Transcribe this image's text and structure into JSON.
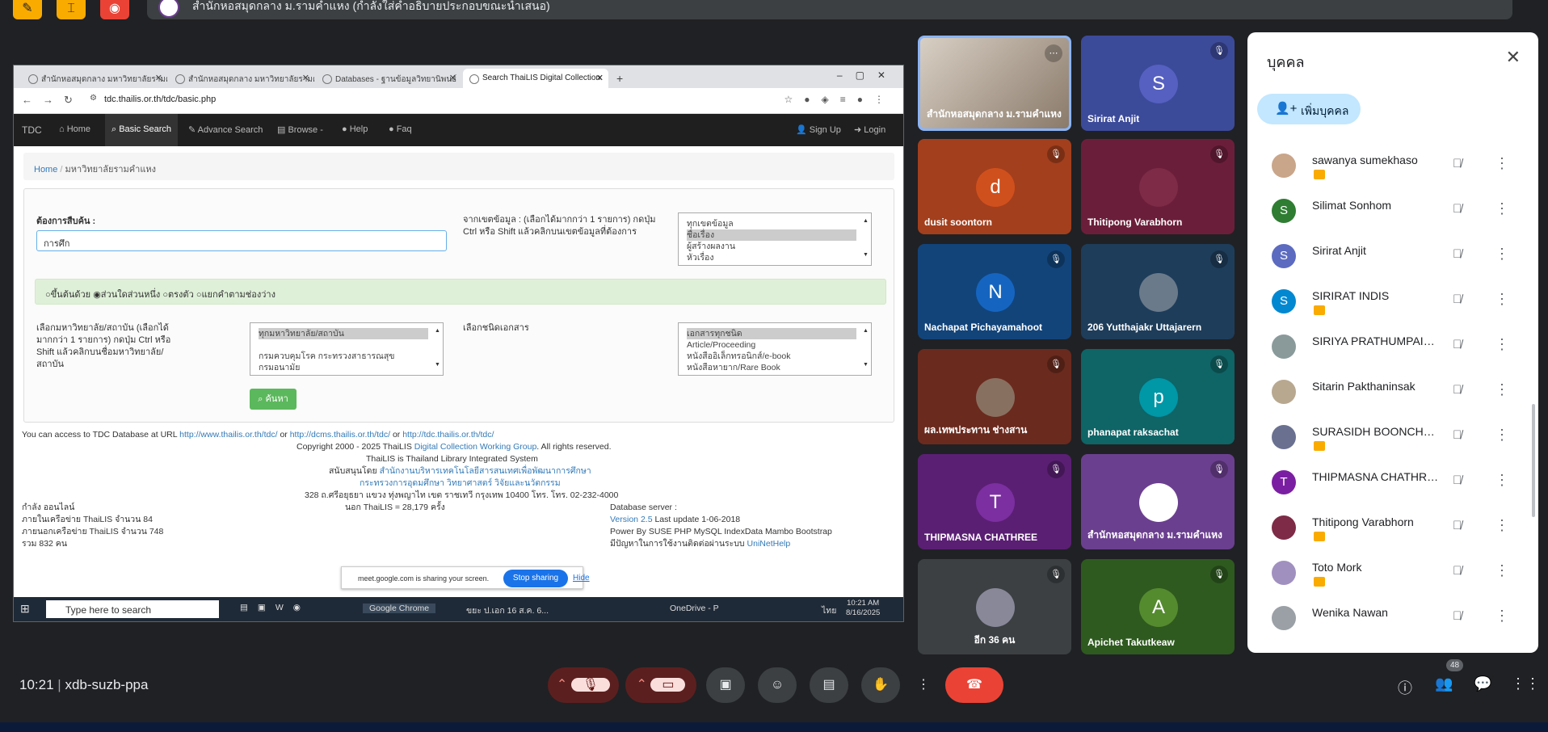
{
  "presentation": {
    "title": "สำนักหอสมุดกลาง ม.รามคำแหง (กำลังใส่คำอธิบายประกอบขณะนำเสนอ)"
  },
  "browser": {
    "tabs": [
      {
        "label": "สำนักหอสมุดกลาง มหาวิทยาลัยรามคำ"
      },
      {
        "label": "สำนักหอสมุดกลาง มหาวิทยาลัยรามคำ"
      },
      {
        "label": "Databases - ฐานข้อมูลวิทยานิพนธ์"
      },
      {
        "label": "Search ThaiLIS Digital Collection"
      }
    ],
    "url": "tdc.thailis.or.th/tdc/basic.php"
  },
  "site": {
    "brand": "TDC",
    "nav": [
      "Home",
      "Basic Search",
      "Advance Search",
      "Browse -",
      "Help",
      "Faq"
    ],
    "signup": "Sign Up",
    "login": "Login",
    "breadcrumb_home": "Home",
    "breadcrumb_current": "มหาวิทยาลัยรามคำแหง",
    "search_label": "ต้องการสืบค้น :",
    "search_value": "การศึก",
    "field_help": "จากเขตข้อมูล : (เลือกได้มากกว่า 1 รายการ) กดปุ่ม Ctrl หรือ Shift แล้วคลิกบนเขตข้อมูลที่ต้องการ",
    "fields": [
      "ทุกเขตข้อมูล",
      "ชื่อเรื่อง",
      "ผู้สร้างผลงาน",
      "หัวเรื่อง"
    ],
    "radios": [
      "ขึ้นต้นด้วย",
      "ส่วนใดส่วนหนึ่ง",
      "ตรงตัว",
      "แยกคำตามช่องว่าง"
    ],
    "inst_help": "เลือกมหาวิทยาลัย/สถาบัน (เลือกได้มากกว่า 1 รายการ) กดปุ่ม Ctrl หรือ Shift แล้วคลิกบนชื่อมหาวิทยาลัย/สถาบัน",
    "institutions": [
      "ทุกมหาวิทยาลัย/สถาบัน",
      "",
      "กรมควบคุมโรค กระทรวงสาธารณสุข",
      "กรมอนามัย"
    ],
    "doc_help": "เลือกชนิดเอกสาร",
    "doc_types": [
      "เอกสารทุกชนิด",
      "Article/Proceeding",
      "หนังสืออิเล็กทรอนิกส์/e-book",
      "หนังสือหายาก/Rare Book"
    ],
    "search_button": "ค้นหา",
    "footer_access": "You can access to TDC Database at URL",
    "footer_url1": "http://www.thailis.or.th/tdc/",
    "footer_or1": "or",
    "footer_url2": "http://dcms.thailis.or.th/tdc/",
    "footer_or2": "or",
    "footer_url3": "http://tdc.thailis.or.th/tdc/",
    "copyright": "Copyright 2000 - 2025 ThaiLIS",
    "copyright_link": "Digital Collection Working Group",
    "copyright_tail": ". All rights reserved.",
    "thailis_line": "ThaiLIS is Thailand Library Integrated System",
    "support_label": "สนับสนุนโดย",
    "support_org": "สำนักงานบริหารเทคโนโลยีสารสนเทศเพื่อพัฒนาการศึกษา",
    "ministry": "กระทรวงการอุดมศึกษา วิทยาศาสตร์ วิจัยและนวัตกรรม",
    "address": "328 ถ.ศรีอยุธยา แขวง ทุ่งพญาไท เขต ราชเทวี กรุงเทพ 10400 โทร. โทร. 02-232-4000",
    "online": "กำลัง ออนไลน์",
    "online_in": "ภายในเครือข่าย ThaiLIS จำนวน 84",
    "online_out": "ภายนอกเครือข่าย ThaiLIS จำนวน 748",
    "online_total": "รวม 832 คน",
    "outside": "นอก ThaiLIS = 28,179 ครั้ง",
    "db_server": "Database server :",
    "version": "Version 2.5",
    "last_update": "Last update 1-06-2018",
    "powered": "Power By SUSE PHP MySQL IndexData Mambo Bootstrap",
    "problem": "มีปัญหาในการใช้งานติดต่อผ่านระบบ",
    "help_link": "UniNetHelp"
  },
  "share_bar": {
    "text": "meet.google.com is sharing your screen.",
    "stop": "Stop sharing",
    "hide": "Hide"
  },
  "taskbar": {
    "search": "Type here to search",
    "chrome": "Google Chrome",
    "doc": "ขยะ ป.เอก 16 ส.ค. 6...",
    "onedrive": "OneDrive - P",
    "lang": "ไทย",
    "time": "10:21 AM",
    "date": "8/16/2025"
  },
  "tiles": [
    {
      "name": "สำนักหอสมุดกลาง ม.รามคำแหง",
      "type": "video",
      "color": "#8a7a6a"
    },
    {
      "name": "Sirirat Anjit",
      "initial": "S",
      "bg": "#3c4a9a",
      "avc": "#5560c0"
    },
    {
      "name": "dusit soontorn",
      "initial": "d",
      "bg": "#a33f1d",
      "avc": "#d0501d"
    },
    {
      "name": "Thitipong Varabhorn",
      "initial": "",
      "bg": "#6b1e3a",
      "avc": "#7d2b47"
    },
    {
      "name": "Nachapat Pichayamahoot",
      "initial": "N",
      "bg": "#12447a",
      "avc": "#1565c0"
    },
    {
      "name": "206 Yutthajakr Uttajarern",
      "initial": "",
      "bg": "#1e3d5a",
      "avc": "#6a7a8a"
    },
    {
      "name": "ผล.เทพประทาน ช่างสาน",
      "initial": "",
      "bg": "#6a2a1e",
      "avc": "#887060"
    },
    {
      "name": "phanapat raksachat",
      "initial": "p",
      "bg": "#0f6466",
      "avc": "#0097a7"
    },
    {
      "name": "THIPMASNA CHATHREE",
      "initial": "T",
      "bg": "#5a1f73",
      "avc": "#7b2fa0"
    },
    {
      "name": "สำนักหอสมุดกลาง ม.รามคำแหง",
      "initial": "",
      "bg": "#6b3f8f",
      "avc": "#ffffff"
    },
    {
      "name": "อีก 36 คน",
      "initial": "",
      "bg": "#3c4043",
      "avc": "#889"
    },
    {
      "name": "Apichet Takutkeaw",
      "initial": "A",
      "bg": "#2e5a1f",
      "avc": "#558b2f"
    }
  ],
  "people": {
    "title": "บุคคล",
    "add": "เพิ่มบุคคล",
    "list": [
      {
        "name": "sawanya sumekhaso",
        "initial": "",
        "color": "#c9a58a",
        "badge": true
      },
      {
        "name": "Silimat Sonhom",
        "initial": "S",
        "color": "#2e7d32",
        "badge": false
      },
      {
        "name": "Sirirat Anjit",
        "initial": "S",
        "color": "#5c6bc0",
        "badge": false
      },
      {
        "name": "SIRIRAT INDIS",
        "initial": "S",
        "color": "#0288d1",
        "badge": true
      },
      {
        "name": "SIRIYA PRATHUMPAISAN",
        "initial": "",
        "color": "#8a9a9a",
        "badge": false
      },
      {
        "name": "Sitarin Pakthaninsak",
        "initial": "",
        "color": "#b8a890",
        "badge": false
      },
      {
        "name": "SURASIDH BOONCHUN...",
        "initial": "",
        "color": "#6a7090",
        "badge": true
      },
      {
        "name": "THIPMASNA CHATHREE",
        "initial": "T",
        "color": "#7b1fa2",
        "badge": false
      },
      {
        "name": "Thitipong Varabhorn",
        "initial": "",
        "color": "#7d2b47",
        "badge": true
      },
      {
        "name": "Toto Mork",
        "initial": "",
        "color": "#a090c0",
        "badge": true
      },
      {
        "name": "Wenika Nawan",
        "initial": "",
        "color": "#9aa0a6",
        "badge": false
      }
    ]
  },
  "meeting": {
    "time": "10:21",
    "code": "xdb-suzb-ppa",
    "participants": "48"
  }
}
